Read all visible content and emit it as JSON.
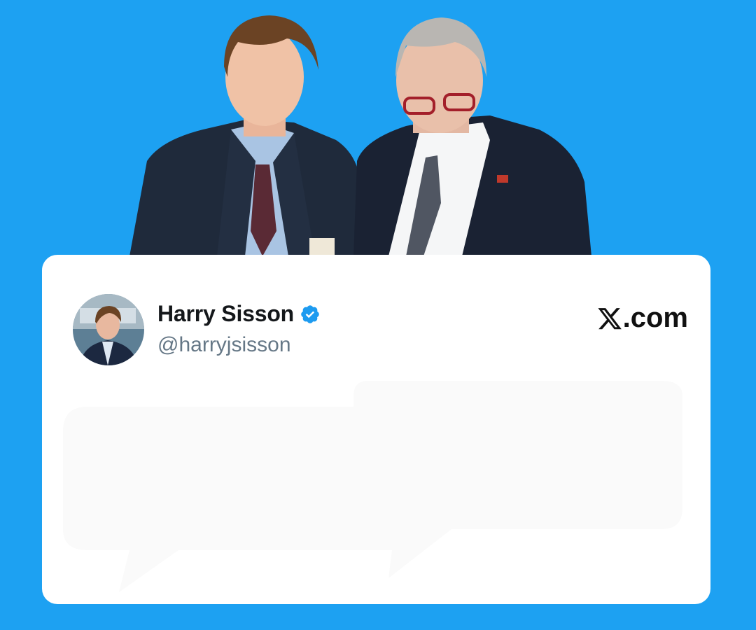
{
  "post": {
    "author_name": "Harry Sisson",
    "author_handle": "@harryjsisson",
    "verified": true,
    "brand_label": ".com"
  },
  "icons": {
    "verified": "verified-badge-icon",
    "brand": "x-logo-icon"
  },
  "colors": {
    "background": "#1da1f2",
    "card": "#ffffff",
    "verified": "#1d9bf0",
    "handle": "#657786"
  }
}
